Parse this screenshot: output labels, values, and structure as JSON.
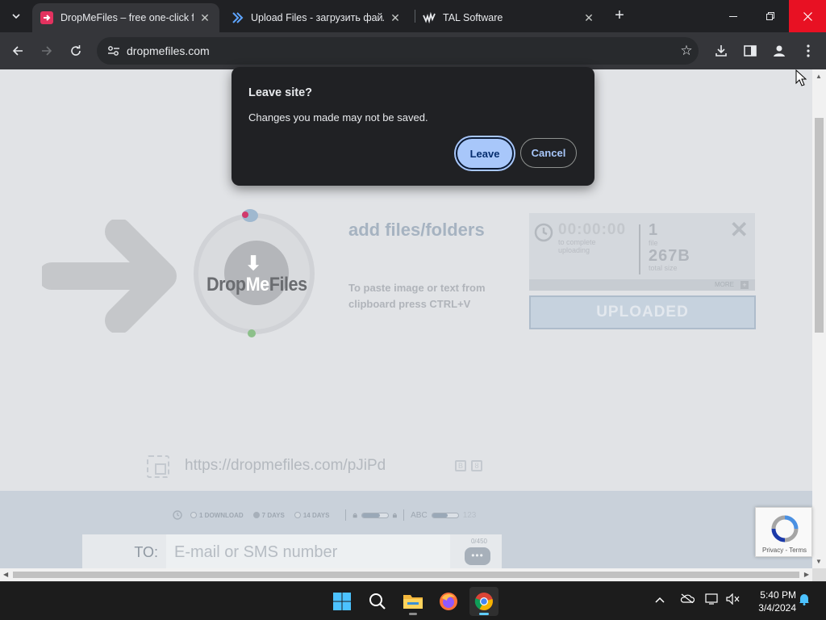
{
  "tabs": [
    {
      "title": "DropMeFiles – free one-click fil",
      "active": true,
      "favicon": "dropmefiles-favicon"
    },
    {
      "title": "Upload Files - загрузить файл",
      "active": false,
      "favicon": "chevron-favicon"
    },
    {
      "title": "TAL Software",
      "active": false,
      "favicon": "tal-favicon"
    }
  ],
  "toolbar": {
    "url": "dropmefiles.com"
  },
  "dialog": {
    "title": "Leave site?",
    "message": "Changes you made may not be saved.",
    "leave_label": "Leave",
    "cancel_label": "Cancel"
  },
  "page": {
    "logo_left": "Drop",
    "logo_me": "Me",
    "logo_right": "Files",
    "add_title": "add files/folders",
    "add_hint": "To paste image or text from clipboard press CTRL+V",
    "timer": "00:00:00",
    "timer_label": "to complete uploading",
    "files_count": "1",
    "files_label": "file",
    "total_size": "267B",
    "total_size_label": "total size",
    "more_label": "MORE",
    "uploaded_label": "UPLOADED",
    "share_url": "https://dropmefiles.com/pJiPd",
    "options": {
      "one_download": "1 DOWNLOAD",
      "seven_days": "7 DAYS",
      "fourteen_days": "14 DAYS",
      "selected": "7 DAYS",
      "abc_label": "ABC",
      "abc_count": "123",
      "lock_level": 0.7,
      "abc_level": 0.6
    },
    "to_label": "TO:",
    "to_placeholder": "E-mail or SMS number",
    "char_count": "0/450"
  },
  "recaptcha": {
    "terms": "Privacy - Terms"
  },
  "taskbar": {
    "time": "5:40 PM",
    "date": "3/4/2024"
  },
  "colors": {
    "accent": "#a8c7fa",
    "chrome_dark": "#202124",
    "close_red": "#e81123"
  }
}
